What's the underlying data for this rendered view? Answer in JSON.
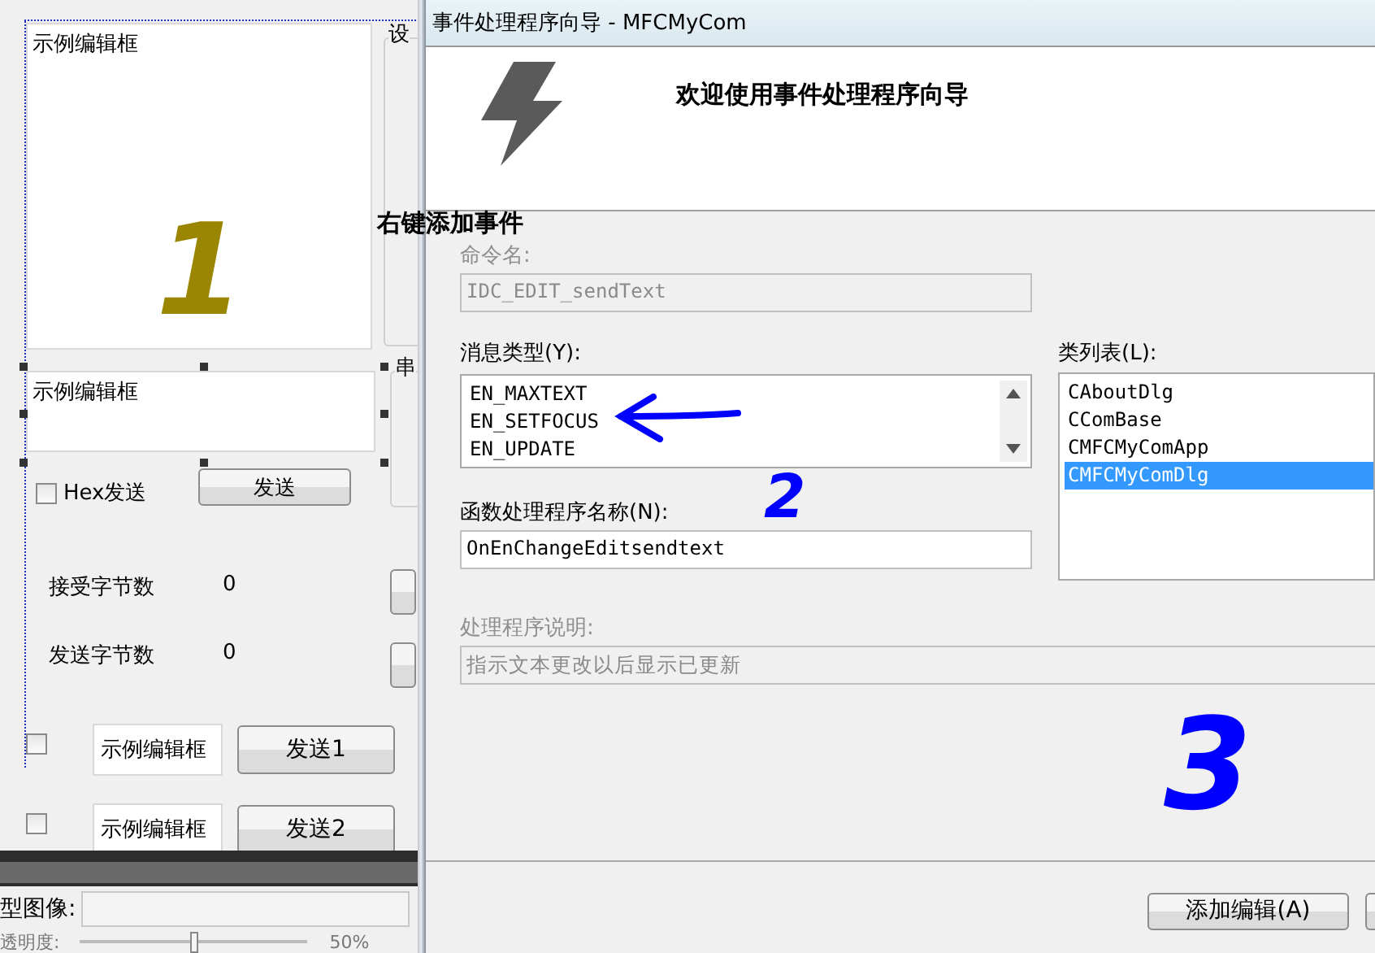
{
  "designer": {
    "edit_large": {
      "value": "示例编辑框"
    },
    "group_1": {
      "label": "设"
    },
    "group_2": {
      "label": "串"
    },
    "edit_send": {
      "value": "示例编辑框"
    },
    "hex_checkbox": {
      "label": "Hex发送",
      "checked": false
    },
    "send_button": "发送",
    "counters": [
      {
        "label": "接受字节数",
        "value": "0"
      },
      {
        "label": "发送字节数",
        "value": "0"
      }
    ],
    "send_rows": [
      {
        "checked": false,
        "value": "示例编辑框",
        "button": "发送1"
      },
      {
        "checked": false,
        "value": "示例编辑框",
        "button": "发送2"
      }
    ],
    "image_label": "型图像:",
    "opacity": {
      "label": "透明度:",
      "level": 0.5,
      "reading": "50%"
    }
  },
  "annotations": [
    {
      "kind": "digit",
      "text": "1",
      "color": "#9a8600"
    },
    {
      "kind": "note",
      "text": "右键添加事件",
      "color": "#000000"
    },
    {
      "kind": "digit",
      "text": "2",
      "color": "#0000ff"
    },
    {
      "kind": "digit",
      "text": "3",
      "color": "#0000ff"
    }
  ],
  "dialog": {
    "title": "事件处理程序向导 - MFCMyCom",
    "heading": "欢迎使用事件处理程序向导",
    "command_label": "命令名:",
    "command_value": "IDC_EDIT_sendText",
    "message_label": "消息类型(Y):",
    "messages": [
      {
        "text": "EN_MAXTEXT",
        "selected": false
      },
      {
        "text": "EN_SETFOCUS",
        "selected": false
      },
      {
        "text": "EN_UPDATE",
        "selected": false
      }
    ],
    "class_label": "类列表(L):",
    "classes": [
      {
        "text": "CAboutDlg",
        "selected": false
      },
      {
        "text": "CComBase",
        "selected": false
      },
      {
        "text": "CMFCMyComApp",
        "selected": false
      },
      {
        "text": "CMFCMyComDlg",
        "selected": true
      }
    ],
    "function_label": "函数处理程序名称(N):",
    "function_value": "OnEnChangeEditsendtext",
    "description_label": "处理程序说明:",
    "description_value": "指示文本更改以后显示已更新",
    "add_button": "添加编辑(A)"
  }
}
